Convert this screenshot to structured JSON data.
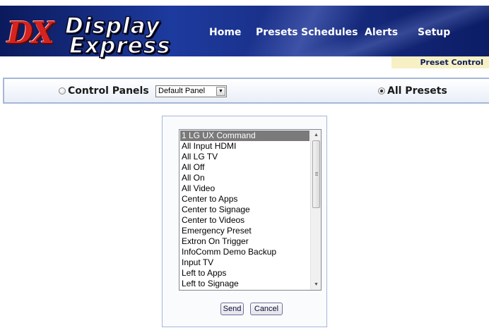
{
  "brand": {
    "logo_letters": "DX",
    "name_line1": "Display",
    "name_line2": "Express"
  },
  "nav": {
    "home": "Home",
    "presets": "Presets",
    "schedules": "Schedules",
    "alerts": "Alerts",
    "setup": "Setup"
  },
  "section_title": "Preset Control",
  "selector": {
    "control_panels_label": "Control Panels",
    "panel_select_value": "Default Panel",
    "all_presets_label": "All Presets",
    "selected_option": "All Presets"
  },
  "presets": {
    "items": [
      "1 LG UX Command",
      "All Input HDMI",
      "All LG TV",
      "All Off",
      "All On",
      "All Video",
      "Center to Apps",
      "Center to Signage",
      "Center to Videos",
      "Emergency Preset",
      "Extron On Trigger",
      "InfoComm Demo Backup",
      "Input TV",
      "Left to Apps",
      "Left to Signage"
    ],
    "selected": "1 LG UX Command"
  },
  "buttons": {
    "send": "Send",
    "cancel": "Cancel"
  },
  "colors": {
    "banner_dark": "#0b1a5c",
    "banner_light": "#1d3a9e",
    "logo_red": "#d6231f",
    "section_tab_bg": "#f6f0c4",
    "panel_border": "#a5b7d8",
    "selected_row": "#7a7a7a"
  }
}
